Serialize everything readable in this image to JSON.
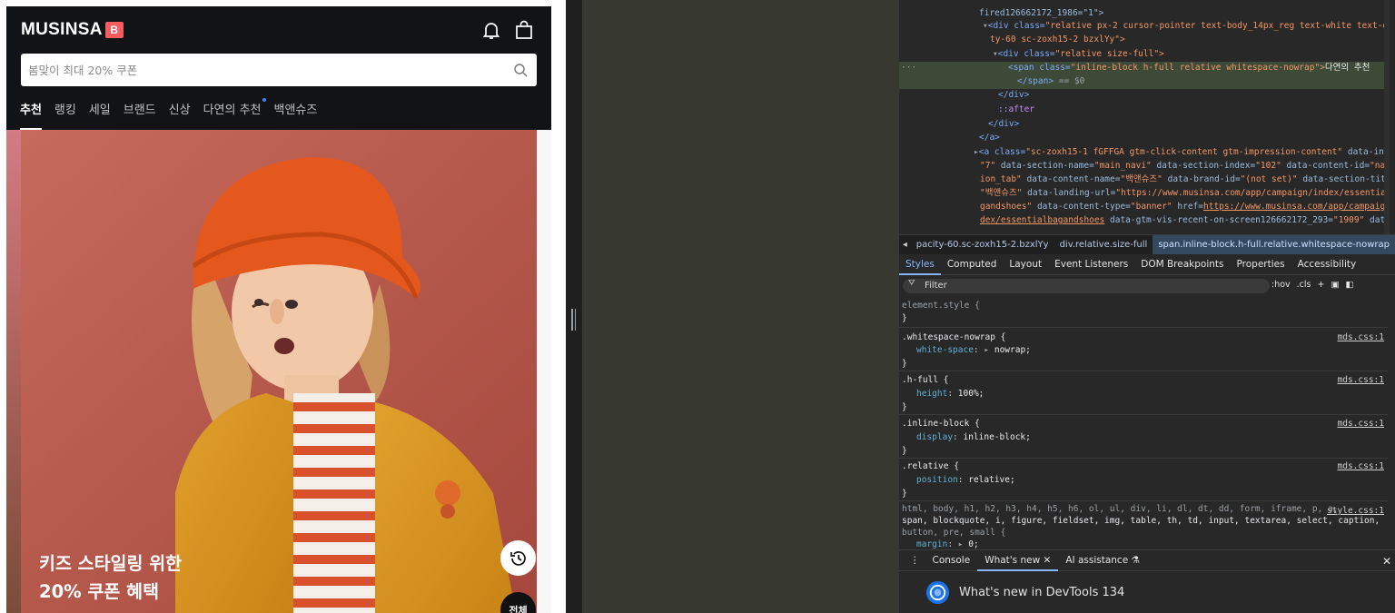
{
  "site": {
    "logo_text": "MUSINSA",
    "logo_badge": "B",
    "search_placeholder": "봄맞이 최대 20% 쿠폰",
    "tabs": [
      {
        "label": "추천",
        "active": true
      },
      {
        "label": "랭킹"
      },
      {
        "label": "세일"
      },
      {
        "label": "브랜드"
      },
      {
        "label": "신상"
      },
      {
        "label": "다연의 추천",
        "dot": true
      },
      {
        "label": "백앤슈즈"
      }
    ],
    "banner": {
      "title_line1": "키즈 스타일링 위한",
      "title_line2": "20% 쿠폰 혜택",
      "all_button": "전체"
    },
    "icons": [
      "bell-icon",
      "bag-icon",
      "search-icon",
      "history-icon"
    ]
  },
  "devtools": {
    "tree": {
      "l1": "fired126662172_1986=\"1\">",
      "l2_tag": "<div class=",
      "l2_val": "\"relative px-2 cursor-pointer text-body_14px_reg text-white text-opaci",
      "l3_val": "ty-60 sc-zoxh15-2 bzxlYy\">",
      "l4_tag": "<div class=",
      "l4_val": "\"relative size-full\">",
      "l5_tag": "<span class=",
      "l5_val": "\"inline-block h-full relative whitespace-nowrap\">",
      "l5_text": "다연의 추천",
      "l6_tag": "</span>",
      "l6_text": "== $0",
      "l7": "</div>",
      "l8": "::after",
      "l9": "</div>",
      "l10": "</a>",
      "l11_tag": "<a class=",
      "l11_val": "\"sc-zoxh15-1 fGFFGA gtm-click-content gtm-impression-content\"",
      "l11_attr": "data-index=",
      "l12_val": "\"7\"",
      "l12_attr": "data-section-name=",
      "l12_val2": "\"main_navi\"",
      "l12_attr2": "data-section-index=",
      "l12_val3": "\"102\"",
      "l12_attr3": "data-content-id=",
      "l12_val4": "\"navigat",
      "l13_val": "ion_tab\"",
      "l13_attr": "data-content-name=",
      "l13_val2": "\"백앤슈즈\"",
      "l13_attr2": "data-brand-id=",
      "l13_val3": "\"(not set)\"",
      "l13_attr3": "data-section-title=",
      "l14_val": "\"백앤슈즈\"",
      "l14_attr": "data-landing-url=",
      "l14_val2": "\"https://www.musinsa.com/app/campaign/index/essentialba",
      "l15_val": "gandshoes\"",
      "l15_attr": "data-content-type=",
      "l15_val2": "\"banner\"",
      "l15_attr2": "href=",
      "l15_link": "https://www.musinsa.com/app/campaign/in",
      "l16_link": "dex/essentialbagandshoes",
      "l16_attr": "data-gtm-vis-recent-on-screen126662172_293=",
      "l16_val": "\"1909\"",
      "l16_attr2": "data-"
    },
    "breadcrumbs": [
      "pacity-60.sc-zoxh15-2.bzxlYy",
      "div.relative.size-full",
      "span.inline-block.h-full.relative.whitespace-nowrap"
    ],
    "styles_tabs": [
      "Styles",
      "Computed",
      "Layout",
      "Event Listeners",
      "DOM Breakpoints",
      "Properties",
      "Accessibility"
    ],
    "filter_placeholder": "Filter",
    "filter_tools": [
      ":hov",
      ".cls"
    ],
    "rules": [
      {
        "selector": "element.style {",
        "props": [],
        "src": ""
      },
      {
        "selector": ".whitespace-nowrap {",
        "props": [
          {
            "name": "white-space",
            "value": "nowrap;"
          }
        ],
        "src": "mds.css:1"
      },
      {
        "selector": ".h-full {",
        "props": [
          {
            "name": "height",
            "value": "100%;"
          }
        ],
        "src": "mds.css:1"
      },
      {
        "selector": ".inline-block {",
        "props": [
          {
            "name": "display",
            "value": "inline-block;"
          }
        ],
        "src": "mds.css:1"
      },
      {
        "selector": ".relative {",
        "props": [
          {
            "name": "position",
            "value": "relative;"
          }
        ],
        "src": "mds.css:1"
      }
    ],
    "reset_rule": {
      "line1": "html, body, h1, h2, h3, h4, h5, h6, ol, ul, div, li, dl, dt, dd, form, iframe, p, a,",
      "line2": "span, blockquote, i, figure, fieldset, img, table, th, td, input, textarea, select, caption,",
      "line3": "button, pre, small {",
      "prop": "margin",
      "val": "0;",
      "src": "style.css:1"
    },
    "drawer_tabs": [
      "Console",
      "What's new",
      "AI assistance"
    ],
    "whats_new_title": "What's new in DevTools 134"
  }
}
